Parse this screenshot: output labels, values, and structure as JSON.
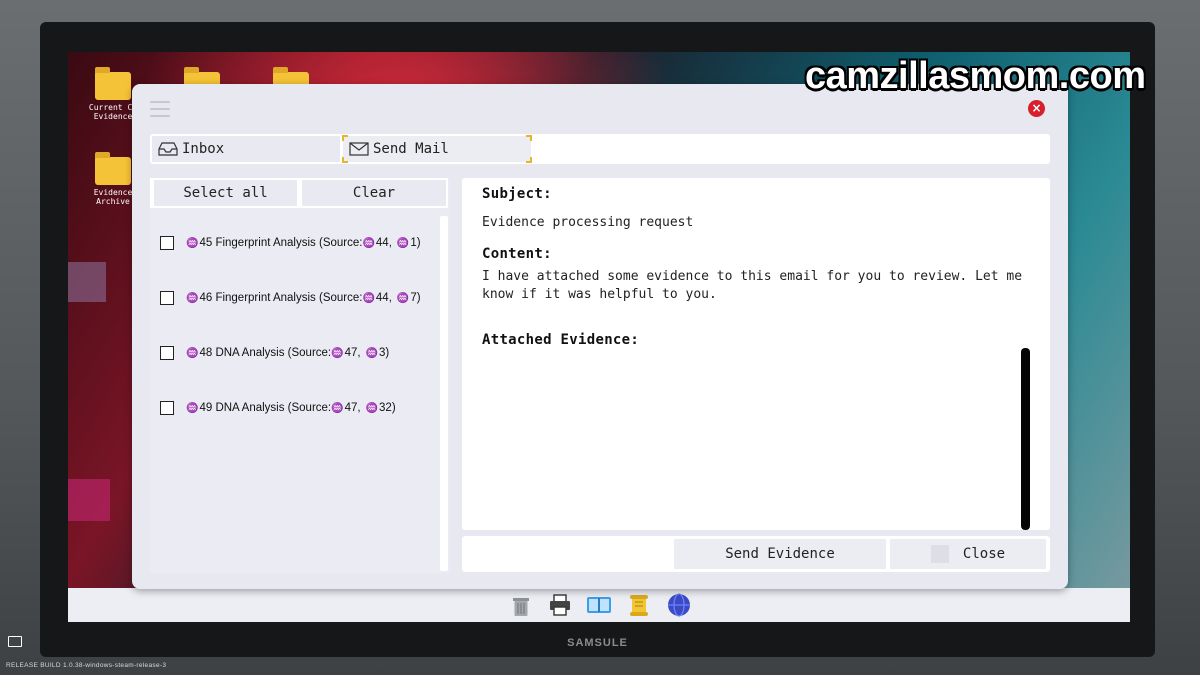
{
  "watermark": "camzillasmom.com",
  "desktop": {
    "icons": [
      {
        "label": "Current Ca\nEvidence"
      },
      {
        "label": ""
      },
      {
        "label": ""
      },
      {
        "label": "Evidence\nArchive"
      }
    ]
  },
  "window": {
    "tabs": [
      {
        "label": "Inbox",
        "icon": "inbox-icon"
      },
      {
        "label": "Send Mail",
        "icon": "mail-envelope-icon"
      }
    ],
    "select_all_label": "Select all",
    "clear_label": "Clear",
    "evidence_items": [
      {
        "glyph": "♒",
        "label": "45 Fingerprint Analysis (Source:",
        "s1": "44,",
        "s2": "1)",
        "checked": false
      },
      {
        "glyph": "♒",
        "label": "46 Fingerprint Analysis (Source:",
        "s1": "44,",
        "s2": "7)",
        "checked": false
      },
      {
        "glyph": "♒",
        "label": "48 DNA Analysis (Source:",
        "s1": "47,",
        "s2": "3)",
        "checked": false
      },
      {
        "glyph": "♒",
        "label": "49 DNA Analysis (Source:",
        "s1": "47,",
        "s2": "32)",
        "checked": false
      }
    ],
    "subject_label": "Subject:",
    "subject_value": "Evidence processing request",
    "content_label": "Content:",
    "content_value": "I have attached some evidence to this email for you to review. Let me know if it was helpful to you.",
    "attached_label": "Attached Evidence:",
    "send_evidence_label": "Send Evidence",
    "close_label": "Close"
  },
  "monitor_brand": "SAMSULE",
  "taskbar_icons": [
    "trash-icon",
    "printer-icon",
    "book-icon",
    "scroll-icon",
    "globe-icon"
  ],
  "footer": "RELEASE   BUILD 1.0.38-windows-steam-release-3",
  "colors": {
    "accent_yellow": "#e7b52b",
    "close_red": "#d8202c",
    "folder": "#f5c337"
  }
}
